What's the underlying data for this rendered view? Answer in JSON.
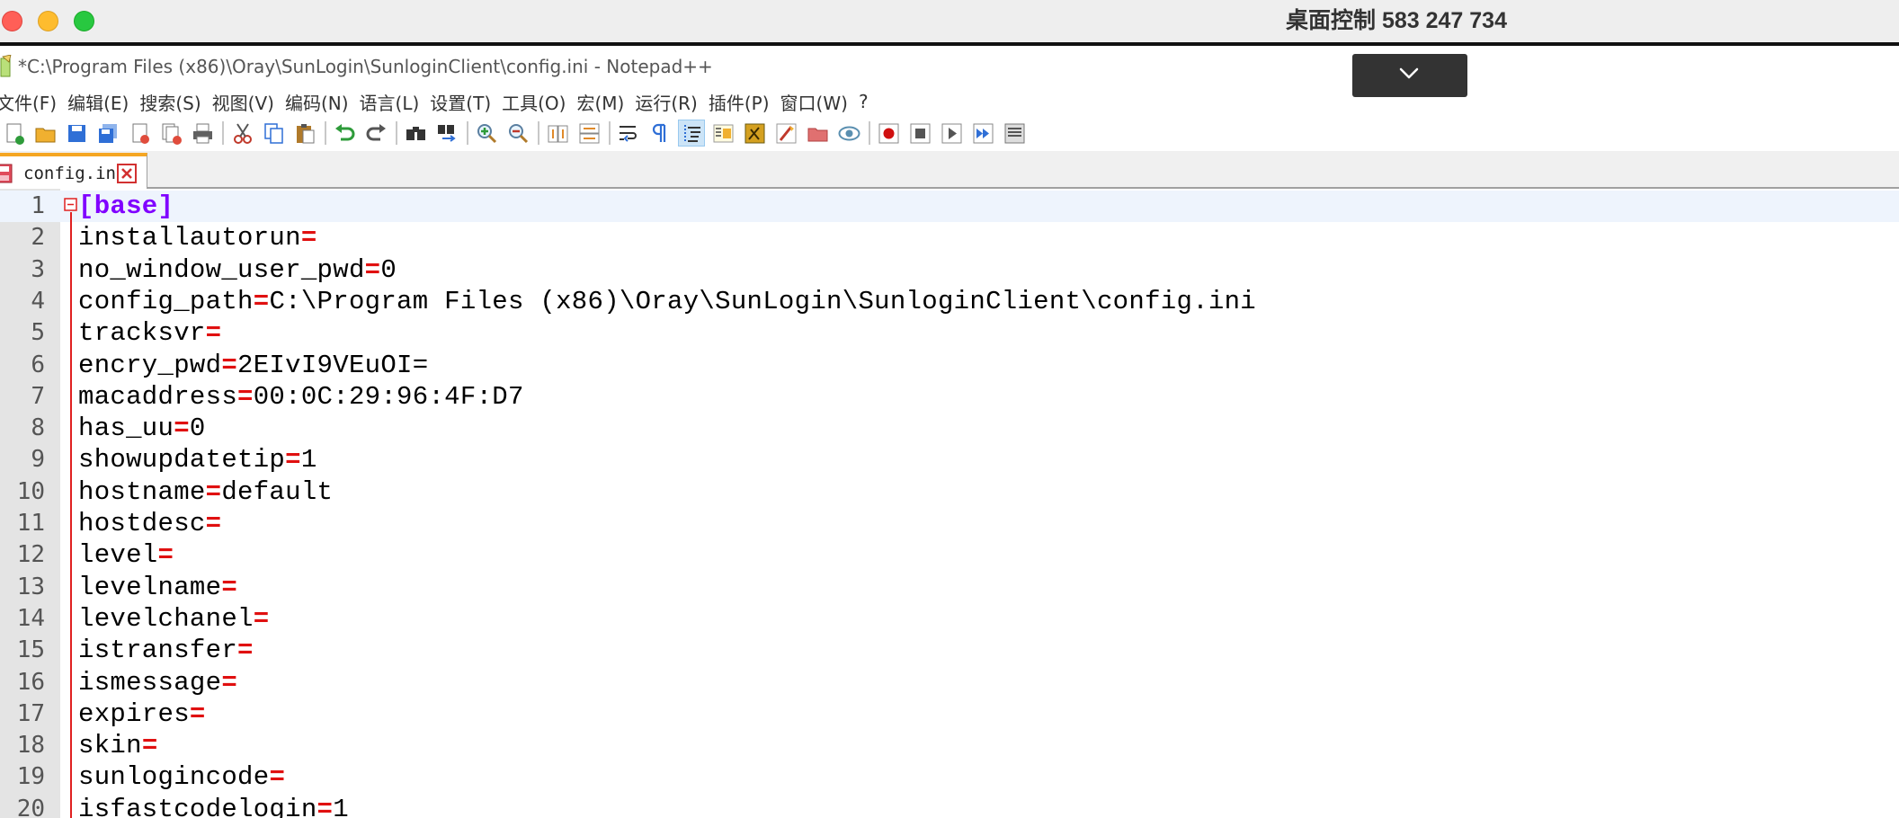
{
  "mac": {
    "remote_title": "桌面控制 583 247 734"
  },
  "window": {
    "title": "*C:\\Program Files (x86)\\Oray\\SunLogin\\SunloginClient\\config.ini - Notepad++"
  },
  "menu": [
    "文件(F)",
    "编辑(E)",
    "搜索(S)",
    "视图(V)",
    "编码(N)",
    "语言(L)",
    "设置(T)",
    "工具(O)",
    "宏(M)",
    "运行(R)",
    "插件(P)",
    "窗口(W)",
    "?"
  ],
  "toolbar": [
    {
      "icon": "new-file-icon",
      "color": "#2e9b3a"
    },
    {
      "icon": "open-file-icon",
      "color": "#f0b030"
    },
    {
      "icon": "save-icon",
      "color": "#2f6fd6"
    },
    {
      "icon": "save-all-icon",
      "color": "#2f6fd6"
    },
    {
      "icon": "close-icon",
      "color": "#e04c3c"
    },
    {
      "icon": "close-all-icon",
      "color": "#e04c3c"
    },
    {
      "icon": "print-icon",
      "color": "#606060"
    },
    {
      "sep": true
    },
    {
      "icon": "cut-icon",
      "color": "#c0392b"
    },
    {
      "icon": "copy-icon",
      "color": "#2f6fd6"
    },
    {
      "icon": "paste-icon",
      "color": "#b07a2a"
    },
    {
      "sep": true
    },
    {
      "icon": "undo-icon",
      "color": "#2e9b3a"
    },
    {
      "icon": "redo-icon",
      "color": "#555555"
    },
    {
      "sep": true
    },
    {
      "icon": "find-icon",
      "color": "#333333"
    },
    {
      "icon": "replace-icon",
      "color": "#2f6fd6"
    },
    {
      "sep": true
    },
    {
      "icon": "zoom-in-icon",
      "color": "#2e9b3a"
    },
    {
      "icon": "zoom-out-icon",
      "color": "#c0392b"
    },
    {
      "sep": true
    },
    {
      "icon": "sync-vertical-icon",
      "color": "#e08a2a"
    },
    {
      "icon": "sync-horizontal-icon",
      "color": "#e08a2a"
    },
    {
      "sep": true
    },
    {
      "icon": "word-wrap-icon",
      "color": "#2f6fd6"
    },
    {
      "icon": "show-all-chars-icon",
      "color": "#2f6fd6"
    },
    {
      "icon": "indent-guide-icon",
      "color": "#2f6fd6",
      "active": true
    },
    {
      "icon": "doc-map-icon",
      "color": "#f0b030"
    },
    {
      "icon": "function-list-icon",
      "color": "#d4a020"
    },
    {
      "icon": "folder-workspace-icon",
      "color": "#c0392b"
    },
    {
      "icon": "folder-icon",
      "color": "#e07070"
    },
    {
      "icon": "monitor-icon",
      "color": "#5a8fb0"
    },
    {
      "sep": true
    },
    {
      "icon": "record-macro-icon",
      "color": "#d01010"
    },
    {
      "icon": "stop-macro-icon",
      "color": "#555555"
    },
    {
      "icon": "play-macro-icon",
      "color": "#555555"
    },
    {
      "icon": "run-macro-multiple-icon",
      "color": "#2f6fd6"
    },
    {
      "icon": "save-macro-icon",
      "color": "#555555"
    }
  ],
  "tab": {
    "label": "config.ini"
  },
  "editor": {
    "lines": [
      {
        "n": "1",
        "section": "[base]"
      },
      {
        "n": "2",
        "key": "installautorun",
        "value": ""
      },
      {
        "n": "3",
        "key": "no_window_user_pwd",
        "value": "0"
      },
      {
        "n": "4",
        "key": "config_path",
        "value": "C:\\Program Files (x86)\\Oray\\SunLogin\\SunloginClient\\config.ini"
      },
      {
        "n": "5",
        "key": "tracksvr",
        "value": ""
      },
      {
        "n": "6",
        "key": "encry_pwd",
        "value": "2EIvI9VEuOI="
      },
      {
        "n": "7",
        "key": "macaddress",
        "value": "00:0C:29:96:4F:D7"
      },
      {
        "n": "8",
        "key": "has_uu",
        "value": "0"
      },
      {
        "n": "9",
        "key": "showupdatetip",
        "value": "1"
      },
      {
        "n": "10",
        "key": "hostname",
        "value": "default"
      },
      {
        "n": "11",
        "key": "hostdesc",
        "value": ""
      },
      {
        "n": "12",
        "key": "level",
        "value": ""
      },
      {
        "n": "13",
        "key": "levelname",
        "value": ""
      },
      {
        "n": "14",
        "key": "levelchanel",
        "value": ""
      },
      {
        "n": "15",
        "key": "istransfer",
        "value": ""
      },
      {
        "n": "16",
        "key": "ismessage",
        "value": ""
      },
      {
        "n": "17",
        "key": "expires",
        "value": ""
      },
      {
        "n": "18",
        "key": "skin",
        "value": ""
      },
      {
        "n": "19",
        "key": "sunlogincode",
        "value": ""
      },
      {
        "n": "20",
        "key": "isfastcodelogin",
        "value": "1"
      }
    ]
  }
}
